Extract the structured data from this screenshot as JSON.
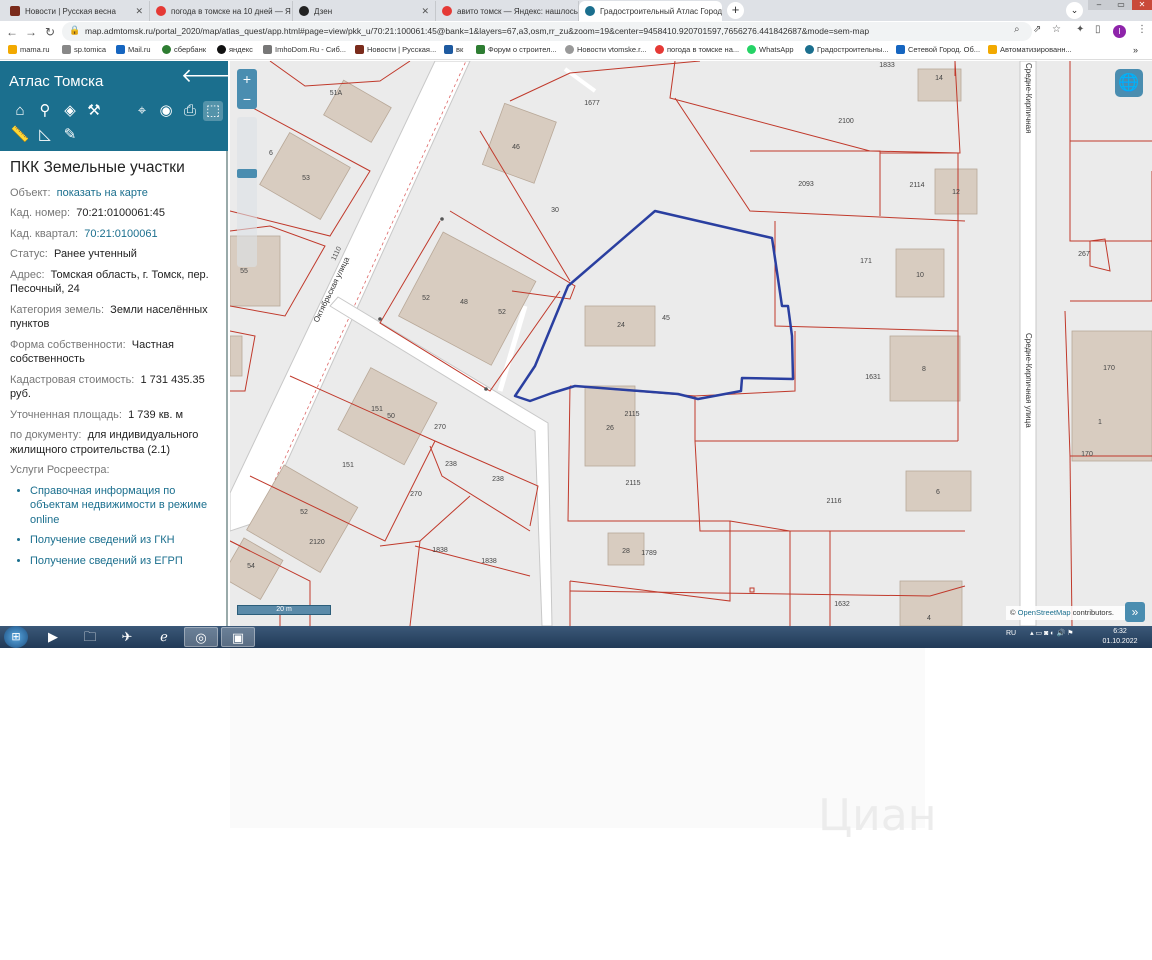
{
  "browser": {
    "tabs": [
      {
        "title": "Новости | Русская весна",
        "color": "#7a2b1b"
      },
      {
        "title": "погода в томске на 10 дней — Я",
        "color": "#e53935"
      },
      {
        "title": "Дзен",
        "color": "#222222"
      },
      {
        "title": "авито томск — Яндекс: нашлось",
        "color": "#e53935"
      },
      {
        "title": "Градостроительный Атлас Город",
        "color": "#1b6f8e"
      }
    ],
    "url": "map.admtomsk.ru/portal_2020/map/atlas_quest/app.html#page=view/pkk_u/70:21:100061:45@bank=1&layers=67,a3,osm,rr_zu&zoom=19&center=9458410.920701597,7656276.441842687&mode=sem-map",
    "profile_initial": "I",
    "bookmarks": [
      {
        "label": "mama.ru",
        "color": "#f2a900"
      },
      {
        "label": "sp.tomica",
        "color": "#888888"
      },
      {
        "label": "Mail.ru",
        "color": "#1565c0"
      },
      {
        "label": "сбербанк",
        "color": "#2e7d32"
      },
      {
        "label": "яндекс",
        "color": "#111111"
      },
      {
        "label": "ImhoDom.Ru - Сиб...",
        "color": "#777777"
      },
      {
        "label": "Новости | Русская...",
        "color": "#7a2b1b"
      },
      {
        "label": "вк",
        "color": "#1e5aa0"
      },
      {
        "label": "Форум о строител...",
        "color": "#2e7d32"
      },
      {
        "label": "Новости vtomske.r...",
        "color": "#999999"
      },
      {
        "label": "погода в томске на...",
        "color": "#e53935"
      },
      {
        "label": "WhatsApp",
        "color": "#25d366"
      },
      {
        "label": "Градостроительны...",
        "color": "#1b6f8e"
      },
      {
        "label": "Сетевой Город. Об...",
        "color": "#1565c0"
      },
      {
        "label": "Автоматизированн...",
        "color": "#f2a900"
      }
    ]
  },
  "panel": {
    "app_title": "Атлас Томска",
    "heading": "ПКК Земельные участки",
    "object_label": "Объект:",
    "object_link": "показать на карте",
    "cad_number_label": "Кад. номер:",
    "cad_number": "70:21:0100061:45",
    "quarter_label": "Кад. квартал:",
    "quarter": "70:21:0100061",
    "status_label": "Статус:",
    "status": "Ранее учтенный",
    "address_label": "Адрес:",
    "address": "Томская область, г. Томск, пер. Песочный, 24",
    "category_label": "Категория земель:",
    "category": "Земли населённых пунктов",
    "ownership_label": "Форма собственности:",
    "ownership": "Частная собственность",
    "cost_label": "Кадастровая стоимость:",
    "cost": "1 731 435.35 руб.",
    "area_label": "Уточненная площадь:",
    "area": "1 739 кв. м",
    "doc_label": "по документу:",
    "doc": "для индивидуального жилищного строительства (2.1)",
    "services_label": "Услуги Росреестра:",
    "services": [
      "Справочная информация по объектам недвижимости в режиме online",
      "Получение сведений из ГКН",
      "Получение сведений из ЕГРП"
    ]
  },
  "map": {
    "street_1": "Октябрьская улица",
    "street_2": "Средне-Кирпичная улица",
    "street_3": "Средне-Кирпичная",
    "road_number": "1110",
    "scale": "20 m",
    "attribution_link": "OpenStreetMap",
    "attribution_rest": " contributors.",
    "zoom_in": "+",
    "zoom_out": "−",
    "parcel_color": "#2a3fa0",
    "boundary_color": "#c0392b",
    "labels": [
      "51А",
      "6",
      "53",
      "55",
      "46",
      "30",
      "1677",
      "1833",
      "14",
      "2100",
      "2093",
      "2114",
      "12",
      "267",
      "52",
      "48",
      "52",
      "24",
      "45",
      "171",
      "10",
      "170",
      "151",
      "50",
      "270",
      "238",
      "26",
      "2115",
      "1631",
      "8",
      "1",
      "170",
      "151",
      "270",
      "238",
      "52",
      "2120",
      "2115",
      "2116",
      "6",
      "28",
      "1789",
      "1838",
      "1838",
      "54",
      "1632",
      "4"
    ]
  },
  "taskbar": {
    "lang": "RU",
    "time": "6:32",
    "date": "01.10.2022"
  },
  "watermark": "Циан"
}
